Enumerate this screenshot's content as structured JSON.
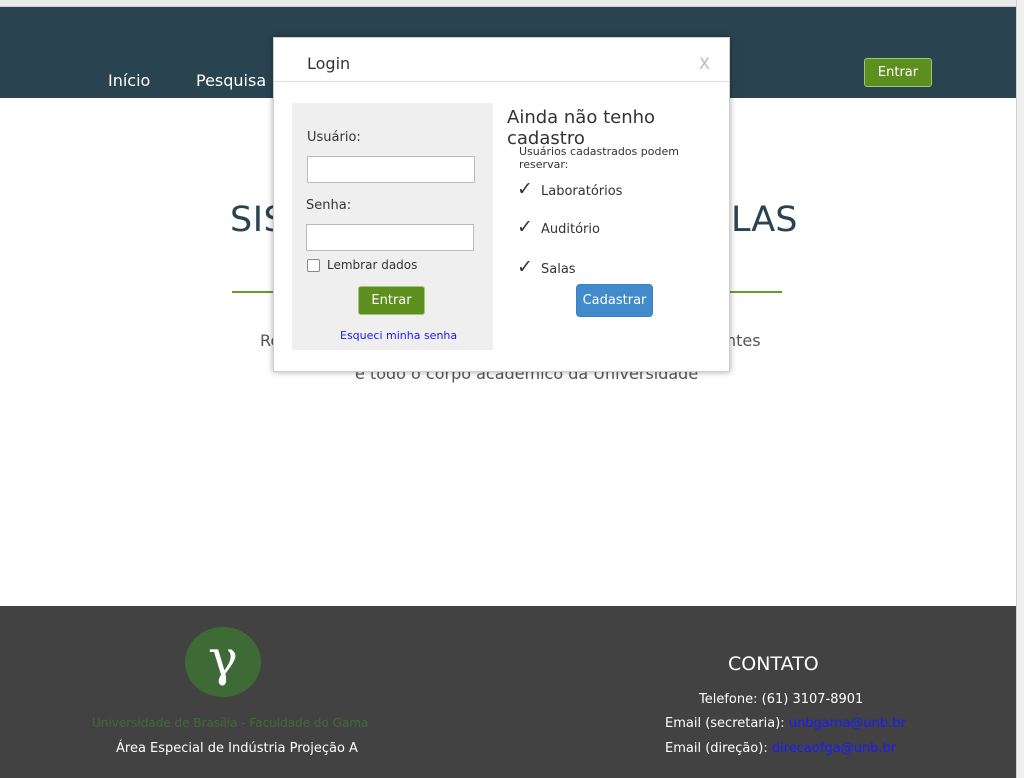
{
  "nav": {
    "items": [
      {
        "label": "Início"
      },
      {
        "label": "Pesquisa"
      }
    ],
    "enter_label": "Entrar"
  },
  "hero": {
    "title_left": "SIS",
    "title_right": "LAS",
    "text_line1_left": "Re",
    "text_line1_right": "ntes",
    "text_line2": "e todo o corpo acadêmico da Universidade"
  },
  "modal": {
    "title": "Login",
    "close_label": "X",
    "login": {
      "user_label": "Usuário:",
      "user_value": "",
      "password_label": "Senha:",
      "password_value": "",
      "remember_label": "Lembrar dados",
      "remember_checked": false,
      "submit_label": "Entrar",
      "forgot_label": "Esqueci minha senha"
    },
    "signup": {
      "title": "Ainda não tenho cadastro",
      "subtitle": "Usuários cadastrados podem reservar:",
      "items": [
        {
          "label": "Laboratórios",
          "icon": "checkmark-icon"
        },
        {
          "label": "Auditório",
          "icon": "checkmark-icon"
        },
        {
          "label": "Salas",
          "icon": "checkmark-icon"
        }
      ],
      "button_label": "Cadastrar"
    }
  },
  "footer": {
    "logo_glyph": "γ",
    "university": "Universidade de Brasília - Faculdade do Gama",
    "address": "Área Especial de Indústria Projeção A",
    "contact_title": "CONTATO",
    "phone": "Telefone: (61) 3107-8901",
    "email_secretaria_label": "Email (secretaria):",
    "email_secretaria": "unbgama@unb.br",
    "email_direcao_label": "Email (direção):",
    "email_direcao": "direcaofga@unb.br"
  },
  "colors": {
    "navbar": "#2a4350",
    "accent_green": "#5d8f1f",
    "primary_blue": "#428bca",
    "footer": "#424242"
  }
}
